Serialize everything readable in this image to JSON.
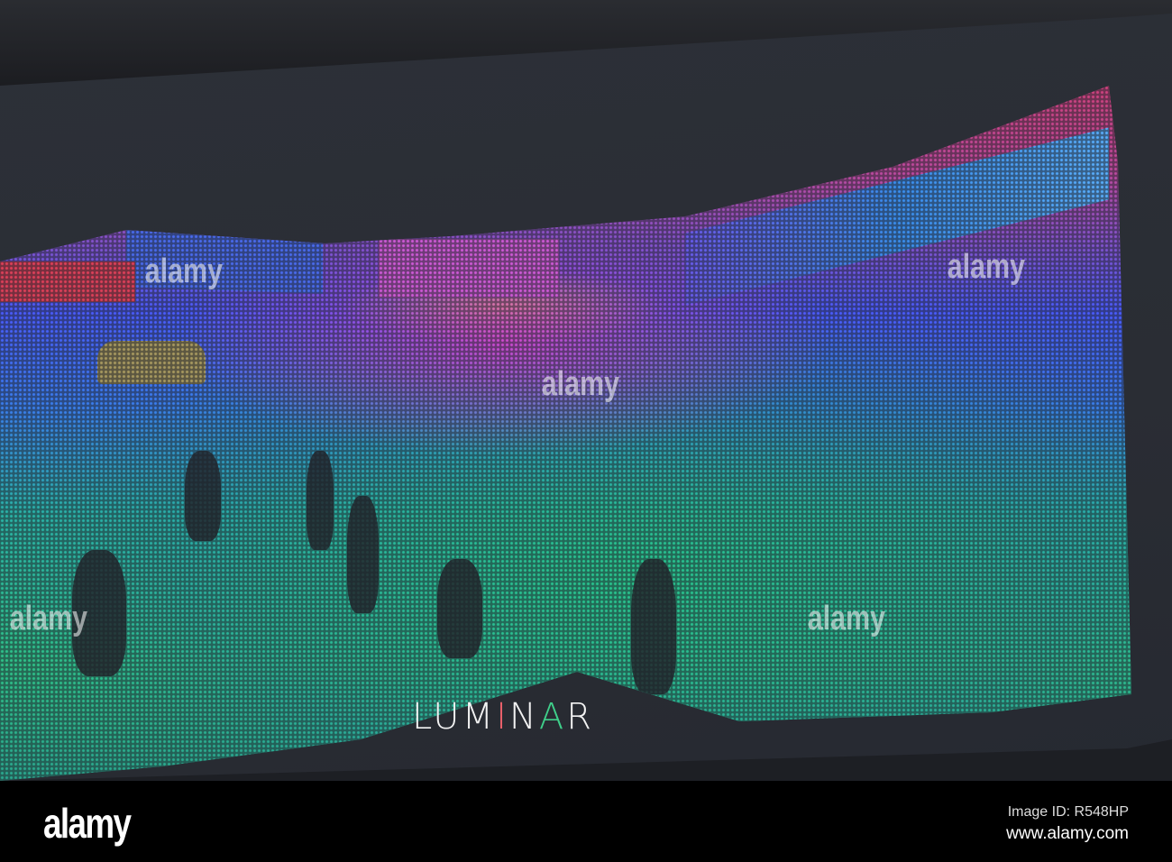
{
  "display": {
    "brand": "LUMINAR"
  },
  "footer": {
    "logo": "alamy",
    "image_id": "Image ID: R548HP",
    "website": "www.alamy.com"
  },
  "watermark": "alamy",
  "colors": {
    "near": "#2fc48a",
    "mid": "#4a5cff",
    "far": "#e23a5c",
    "background": "#2a2d34"
  }
}
